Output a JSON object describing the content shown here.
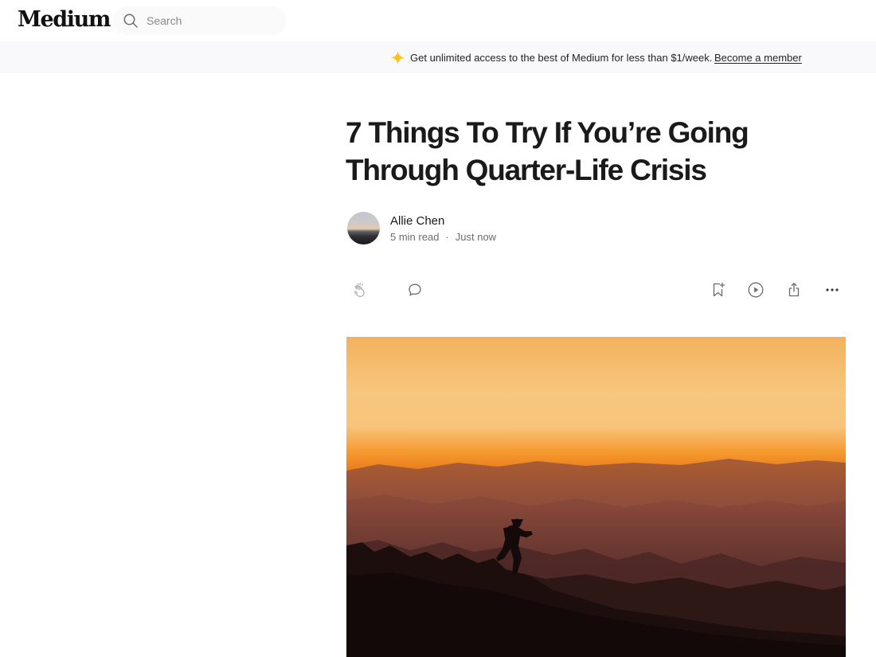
{
  "header": {
    "logo": "Medium",
    "search": {
      "placeholder": "Search",
      "icon": "search-icon"
    }
  },
  "banner": {
    "icon": "sparkle-star-icon",
    "text": "Get unlimited access to the best of Medium for less than $1/week.",
    "link": "Become a member",
    "accent_color": "#ffc017"
  },
  "article": {
    "title": "7 Things To Try If You’re Going Through Quarter-Life Crisis",
    "author": {
      "name": "Allie Chen",
      "read_time": "5 min read",
      "separator": "·",
      "published": "Just now"
    },
    "actions": {
      "left": [
        {
          "name": "clap",
          "icon": "clap-icon"
        },
        {
          "name": "comment",
          "icon": "comment-icon"
        }
      ],
      "right": [
        {
          "name": "bookmark",
          "icon": "bookmark-add-icon"
        },
        {
          "name": "listen",
          "icon": "play-circle-icon"
        },
        {
          "name": "share",
          "icon": "share-icon"
        },
        {
          "name": "more",
          "icon": "more-horizontal-icon"
        }
      ]
    },
    "hero_image": {
      "description_colors": {
        "sky_top": "#f6b04e",
        "horizon": "#f48a1c",
        "ground": "#1a0d0b"
      }
    }
  }
}
